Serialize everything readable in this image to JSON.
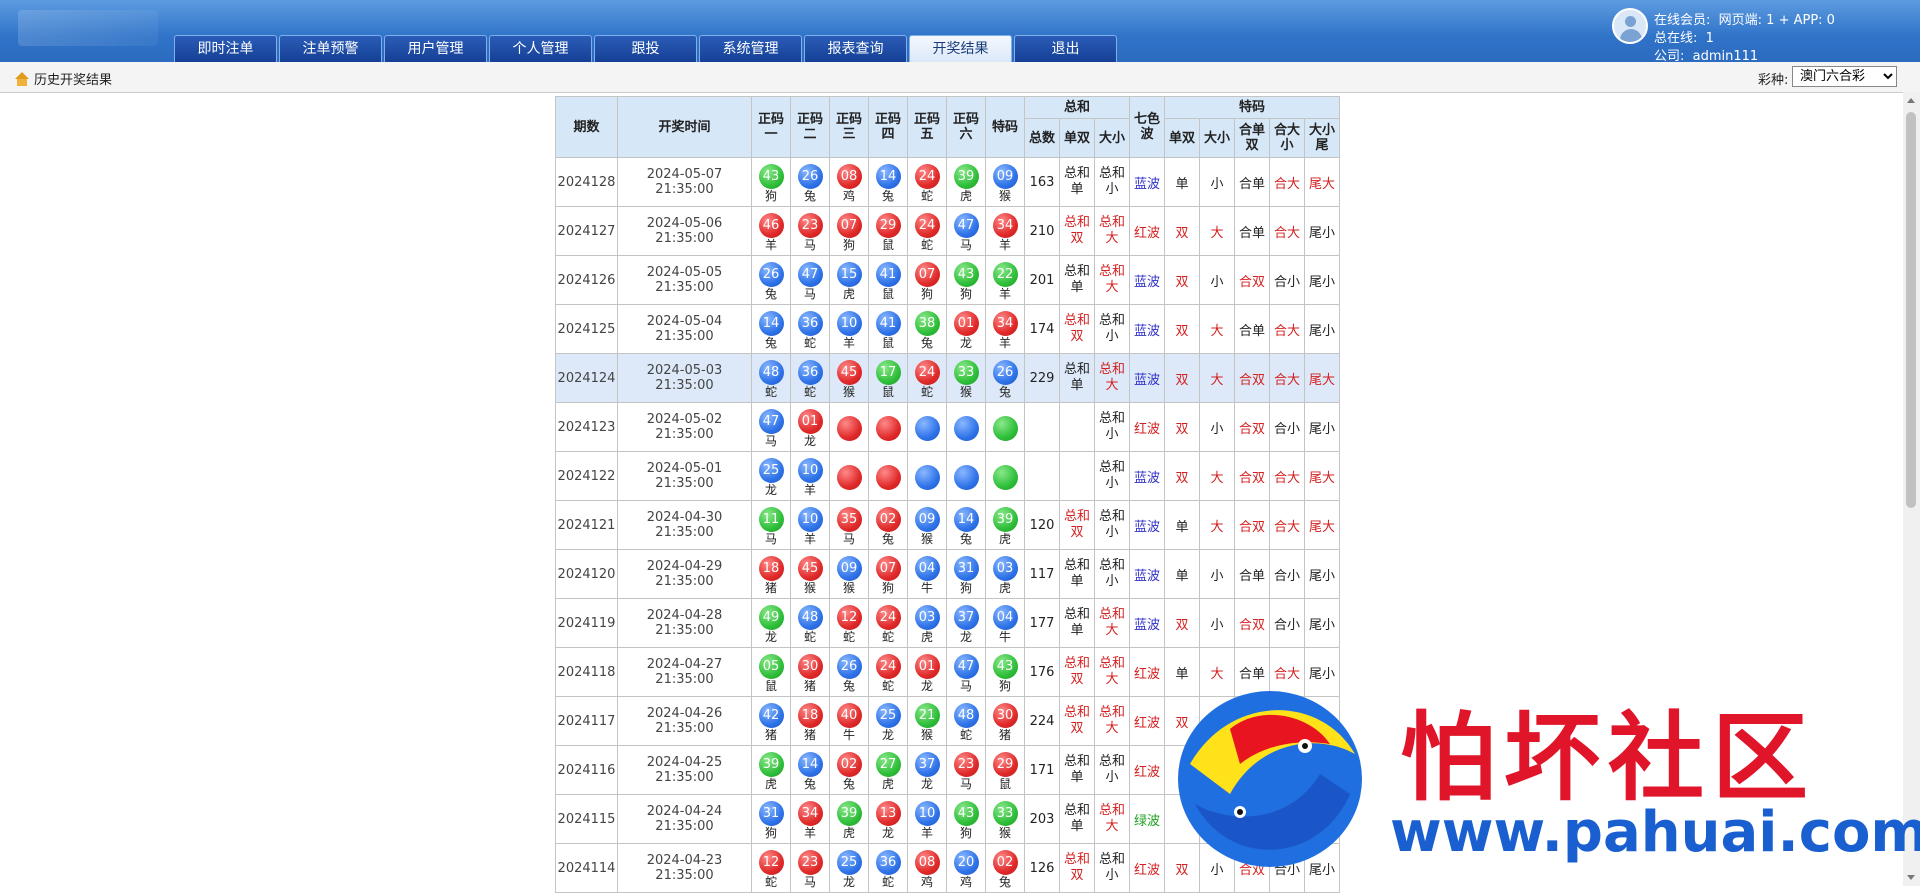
{
  "nav": [
    "即时注单",
    "注单预警",
    "用户管理",
    "个人管理",
    "跟投",
    "系统管理",
    "报表查询",
    "开奖结果",
    "退出"
  ],
  "nav_active": 7,
  "user": {
    "online_label": "在线会员:",
    "online_value": "网页端: 1 + APP: 0",
    "total_label": "总在线:",
    "total_value": "1",
    "company_label": "公司:",
    "company_value": "admin111"
  },
  "toolbar": {
    "breadcrumb": "历史开奖结果",
    "lottery_label": "彩种:",
    "lottery_selected": "澳门六合彩"
  },
  "table": {
    "headers": {
      "period": "期数",
      "time": "开奖时间",
      "z1": "正码一",
      "z2": "正码二",
      "z3": "正码三",
      "z4": "正码四",
      "z5": "正码五",
      "z6": "正码六",
      "special": "特码",
      "sum_group": "总和",
      "special_group": "特码",
      "sum_total": "总数",
      "sum_oe": "单双",
      "sum_bs": "大小",
      "color": "七色波",
      "sp_oe": "单双",
      "sp_bs": "大小",
      "sp_he_oe": "合单双",
      "sp_he_bs": "合大小",
      "sp_tail": "大小尾"
    },
    "rows": [
      {
        "period": "2024128",
        "time": "2024-05-07 21:35:00",
        "balls": [
          [
            "43",
            "狗",
            "green"
          ],
          [
            "26",
            "兔",
            "blue"
          ],
          [
            "08",
            "鸡",
            "red"
          ],
          [
            "14",
            "兔",
            "blue"
          ],
          [
            "24",
            "蛇",
            "red"
          ],
          [
            "39",
            "虎",
            "green"
          ],
          [
            "09",
            "猴",
            "blue"
          ]
        ],
        "total": "163",
        "sum_oe": [
          "总和",
          "单",
          "tblack"
        ],
        "sum_bs": [
          "总和",
          "小",
          "tblack"
        ],
        "color": [
          "蓝波",
          "tblue"
        ],
        "sp": [
          [
            "单",
            "tblack"
          ],
          [
            "小",
            "tblack"
          ],
          [
            "合单",
            "tblack"
          ],
          [
            "合大",
            "tred"
          ],
          [
            "尾大",
            "tred"
          ]
        ]
      },
      {
        "period": "2024127",
        "time": "2024-05-06 21:35:00",
        "balls": [
          [
            "46",
            "羊",
            "red"
          ],
          [
            "23",
            "马",
            "red"
          ],
          [
            "07",
            "狗",
            "red"
          ],
          [
            "29",
            "鼠",
            "red"
          ],
          [
            "24",
            "蛇",
            "red"
          ],
          [
            "47",
            "马",
            "blue"
          ],
          [
            "34",
            "羊",
            "red"
          ]
        ],
        "total": "210",
        "sum_oe": [
          "总和",
          "双",
          "tred"
        ],
        "sum_bs": [
          "总和",
          "大",
          "tred"
        ],
        "color": [
          "红波",
          "tred"
        ],
        "sp": [
          [
            "双",
            "tred"
          ],
          [
            "大",
            "tred"
          ],
          [
            "合单",
            "tblack"
          ],
          [
            "合大",
            "tred"
          ],
          [
            "尾小",
            "tblack"
          ]
        ]
      },
      {
        "period": "2024126",
        "time": "2024-05-05 21:35:00",
        "balls": [
          [
            "26",
            "兔",
            "blue"
          ],
          [
            "47",
            "马",
            "blue"
          ],
          [
            "15",
            "虎",
            "blue"
          ],
          [
            "41",
            "鼠",
            "blue"
          ],
          [
            "07",
            "狗",
            "red"
          ],
          [
            "43",
            "狗",
            "green"
          ],
          [
            "22",
            "羊",
            "green"
          ]
        ],
        "total": "201",
        "sum_oe": [
          "总和",
          "单",
          "tblack"
        ],
        "sum_bs": [
          "总和",
          "大",
          "tred"
        ],
        "color": [
          "蓝波",
          "tblue"
        ],
        "sp": [
          [
            "双",
            "tred"
          ],
          [
            "小",
            "tblack"
          ],
          [
            "合双",
            "tred"
          ],
          [
            "合小",
            "tblack"
          ],
          [
            "尾小",
            "tblack"
          ]
        ]
      },
      {
        "period": "2024125",
        "time": "2024-05-04 21:35:00",
        "balls": [
          [
            "14",
            "兔",
            "blue"
          ],
          [
            "36",
            "蛇",
            "blue"
          ],
          [
            "10",
            "羊",
            "blue"
          ],
          [
            "41",
            "鼠",
            "blue"
          ],
          [
            "38",
            "兔",
            "green"
          ],
          [
            "01",
            "龙",
            "red"
          ],
          [
            "34",
            "羊",
            "red"
          ]
        ],
        "total": "174",
        "sum_oe": [
          "总和",
          "双",
          "tred"
        ],
        "sum_bs": [
          "总和",
          "小",
          "tblack"
        ],
        "color": [
          "蓝波",
          "tblue"
        ],
        "sp": [
          [
            "双",
            "tred"
          ],
          [
            "大",
            "tred"
          ],
          [
            "合单",
            "tblack"
          ],
          [
            "合大",
            "tred"
          ],
          [
            "尾小",
            "tblack"
          ]
        ]
      },
      {
        "period": "2024124",
        "time": "2024-05-03 21:35:00",
        "balls": [
          [
            "48",
            "蛇",
            "blue"
          ],
          [
            "36",
            "蛇",
            "blue"
          ],
          [
            "45",
            "猴",
            "red"
          ],
          [
            "17",
            "鼠",
            "green"
          ],
          [
            "24",
            "蛇",
            "red"
          ],
          [
            "33",
            "猴",
            "green"
          ],
          [
            "26",
            "兔",
            "blue"
          ]
        ],
        "total": "229",
        "sum_oe": [
          "总和",
          "单",
          "tblack"
        ],
        "sum_bs": [
          "总和",
          "大",
          "tred"
        ],
        "color": [
          "蓝波",
          "tblue"
        ],
        "sp": [
          [
            "双",
            "tred"
          ],
          [
            "大",
            "tred"
          ],
          [
            "合双",
            "tred"
          ],
          [
            "合大",
            "tred"
          ],
          [
            "尾大",
            "tred"
          ]
        ]
      },
      {
        "period": "2024123",
        "time": "2024-05-02 21:35:00",
        "balls": [
          [
            "47",
            "马",
            "blue"
          ],
          [
            "01",
            "龙",
            "red"
          ],
          [
            "",
            "",
            "red"
          ],
          [
            "",
            "",
            "red"
          ],
          [
            "",
            "",
            "blue"
          ],
          [
            "",
            "",
            "blue"
          ],
          [
            "",
            "",
            "green"
          ]
        ],
        "total": "",
        "sum_oe": [
          "",
          "",
          "tblack"
        ],
        "sum_bs": [
          "总和",
          "小",
          "tblack"
        ],
        "color": [
          "红波",
          "tred"
        ],
        "sp": [
          [
            "双",
            "tred"
          ],
          [
            "小",
            "tblack"
          ],
          [
            "合双",
            "tred"
          ],
          [
            "合小",
            "tblack"
          ],
          [
            "尾小",
            "tblack"
          ]
        ]
      },
      {
        "period": "2024122",
        "time": "2024-05-01 21:35:00",
        "balls": [
          [
            "25",
            "龙",
            "blue"
          ],
          [
            "10",
            "羊",
            "blue"
          ],
          [
            "",
            "",
            "red"
          ],
          [
            "",
            "",
            "red"
          ],
          [
            "",
            "",
            "blue"
          ],
          [
            "",
            "",
            "blue"
          ],
          [
            "",
            "",
            "green"
          ]
        ],
        "total": "",
        "sum_oe": [
          "",
          "",
          "tblack"
        ],
        "sum_bs": [
          "总和",
          "小",
          "tblack"
        ],
        "color": [
          "蓝波",
          "tblue"
        ],
        "sp": [
          [
            "双",
            "tred"
          ],
          [
            "大",
            "tred"
          ],
          [
            "合双",
            "tred"
          ],
          [
            "合大",
            "tred"
          ],
          [
            "尾大",
            "tred"
          ]
        ]
      },
      {
        "period": "2024121",
        "time": "2024-04-30 21:35:00",
        "balls": [
          [
            "11",
            "马",
            "green"
          ],
          [
            "10",
            "羊",
            "blue"
          ],
          [
            "35",
            "马",
            "red"
          ],
          [
            "02",
            "兔",
            "red"
          ],
          [
            "09",
            "猴",
            "blue"
          ],
          [
            "14",
            "兔",
            "blue"
          ],
          [
            "39",
            "虎",
            "green"
          ]
        ],
        "total": "120",
        "sum_oe": [
          "总和",
          "双",
          "tred"
        ],
        "sum_bs": [
          "总和",
          "小",
          "tblack"
        ],
        "color": [
          "蓝波",
          "tblue"
        ],
        "sp": [
          [
            "单",
            "tblack"
          ],
          [
            "大",
            "tred"
          ],
          [
            "合双",
            "tred"
          ],
          [
            "合大",
            "tred"
          ],
          [
            "尾大",
            "tred"
          ]
        ]
      },
      {
        "period": "2024120",
        "time": "2024-04-29 21:35:00",
        "balls": [
          [
            "18",
            "猪",
            "red"
          ],
          [
            "45",
            "猴",
            "red"
          ],
          [
            "09",
            "猴",
            "blue"
          ],
          [
            "07",
            "狗",
            "red"
          ],
          [
            "04",
            "牛",
            "blue"
          ],
          [
            "31",
            "狗",
            "blue"
          ],
          [
            "03",
            "虎",
            "blue"
          ]
        ],
        "total": "117",
        "sum_oe": [
          "总和",
          "单",
          "tblack"
        ],
        "sum_bs": [
          "总和",
          "小",
          "tblack"
        ],
        "color": [
          "蓝波",
          "tblue"
        ],
        "sp": [
          [
            "单",
            "tblack"
          ],
          [
            "小",
            "tblack"
          ],
          [
            "合单",
            "tblack"
          ],
          [
            "合小",
            "tblack"
          ],
          [
            "尾小",
            "tblack"
          ]
        ]
      },
      {
        "period": "2024119",
        "time": "2024-04-28 21:35:00",
        "balls": [
          [
            "49",
            "龙",
            "green"
          ],
          [
            "48",
            "蛇",
            "blue"
          ],
          [
            "12",
            "蛇",
            "red"
          ],
          [
            "24",
            "蛇",
            "red"
          ],
          [
            "03",
            "虎",
            "blue"
          ],
          [
            "37",
            "龙",
            "blue"
          ],
          [
            "04",
            "牛",
            "blue"
          ]
        ],
        "total": "177",
        "sum_oe": [
          "总和",
          "单",
          "tblack"
        ],
        "sum_bs": [
          "总和",
          "大",
          "tred"
        ],
        "color": [
          "蓝波",
          "tblue"
        ],
        "sp": [
          [
            "双",
            "tred"
          ],
          [
            "小",
            "tblack"
          ],
          [
            "合双",
            "tred"
          ],
          [
            "合小",
            "tblack"
          ],
          [
            "尾小",
            "tblack"
          ]
        ]
      },
      {
        "period": "2024118",
        "time": "2024-04-27 21:35:00",
        "balls": [
          [
            "05",
            "鼠",
            "green"
          ],
          [
            "30",
            "猪",
            "red"
          ],
          [
            "26",
            "兔",
            "blue"
          ],
          [
            "24",
            "蛇",
            "red"
          ],
          [
            "01",
            "龙",
            "red"
          ],
          [
            "47",
            "马",
            "blue"
          ],
          [
            "43",
            "狗",
            "green"
          ]
        ],
        "total": "176",
        "sum_oe": [
          "总和",
          "双",
          "tred"
        ],
        "sum_bs": [
          "总和",
          "大",
          "tred"
        ],
        "color": [
          "红波",
          "tred"
        ],
        "sp": [
          [
            "单",
            "tblack"
          ],
          [
            "大",
            "tred"
          ],
          [
            "合单",
            "tblack"
          ],
          [
            "合大",
            "tred"
          ],
          [
            "尾小",
            "tblack"
          ]
        ]
      },
      {
        "period": "2024117",
        "time": "2024-04-26 21:35:00",
        "balls": [
          [
            "42",
            "猪",
            "blue"
          ],
          [
            "18",
            "猪",
            "red"
          ],
          [
            "40",
            "牛",
            "red"
          ],
          [
            "25",
            "龙",
            "blue"
          ],
          [
            "21",
            "猴",
            "green"
          ],
          [
            "48",
            "蛇",
            "blue"
          ],
          [
            "30",
            "猪",
            "red"
          ]
        ],
        "total": "224",
        "sum_oe": [
          "总和",
          "双",
          "tred"
        ],
        "sum_bs": [
          "总和",
          "大",
          "tred"
        ],
        "color": [
          "红波",
          "tred"
        ],
        "sp": [
          [
            "双",
            "tred"
          ],
          [
            "",
            "tblack"
          ],
          [
            "",
            "tblack"
          ],
          [
            "",
            "tblack"
          ],
          [
            "",
            "tblack"
          ]
        ]
      },
      {
        "period": "2024116",
        "time": "2024-04-25 21:35:00",
        "balls": [
          [
            "39",
            "虎",
            "green"
          ],
          [
            "14",
            "兔",
            "blue"
          ],
          [
            "02",
            "兔",
            "red"
          ],
          [
            "27",
            "虎",
            "green"
          ],
          [
            "37",
            "龙",
            "blue"
          ],
          [
            "23",
            "马",
            "red"
          ],
          [
            "29",
            "鼠",
            "red"
          ]
        ],
        "total": "171",
        "sum_oe": [
          "总和",
          "单",
          "tblack"
        ],
        "sum_bs": [
          "总和",
          "小",
          "tblack"
        ],
        "color": [
          "红波",
          "tred"
        ],
        "sp": [
          [
            "",
            "tblack"
          ],
          [
            "",
            "tblack"
          ],
          [
            "",
            "tblack"
          ],
          [
            "",
            "tblack"
          ],
          [
            "",
            "tblack"
          ]
        ]
      },
      {
        "period": "2024115",
        "time": "2024-04-24 21:35:00",
        "balls": [
          [
            "31",
            "狗",
            "blue"
          ],
          [
            "34",
            "羊",
            "red"
          ],
          [
            "39",
            "虎",
            "green"
          ],
          [
            "13",
            "龙",
            "red"
          ],
          [
            "10",
            "羊",
            "blue"
          ],
          [
            "43",
            "狗",
            "green"
          ],
          [
            "33",
            "猴",
            "green"
          ]
        ],
        "total": "203",
        "sum_oe": [
          "总和",
          "单",
          "tblack"
        ],
        "sum_bs": [
          "总和",
          "大",
          "tred"
        ],
        "color": [
          "绿波",
          "tgreen"
        ],
        "sp": [
          [
            "",
            "tblack"
          ],
          [
            "",
            "tblack"
          ],
          [
            "",
            "tblack"
          ],
          [
            "",
            "tblack"
          ],
          [
            "",
            "tblack"
          ]
        ]
      },
      {
        "period": "2024114",
        "time": "2024-04-23 21:35:00",
        "balls": [
          [
            "12",
            "蛇",
            "red"
          ],
          [
            "23",
            "马",
            "red"
          ],
          [
            "25",
            "龙",
            "blue"
          ],
          [
            "36",
            "蛇",
            "blue"
          ],
          [
            "08",
            "鸡",
            "red"
          ],
          [
            "20",
            "鸡",
            "blue"
          ],
          [
            "02",
            "兔",
            "red"
          ]
        ],
        "total": "126",
        "sum_oe": [
          "总和",
          "双",
          "tred"
        ],
        "sum_bs": [
          "总和",
          "小",
          "tblack"
        ],
        "color": [
          "红波",
          "tred"
        ],
        "sp": [
          [
            "双",
            "tred"
          ],
          [
            "小",
            "tblack"
          ],
          [
            "合双",
            "tred"
          ],
          [
            "合小",
            "tblack"
          ],
          [
            "尾小",
            "tblack"
          ]
        ]
      }
    ],
    "highlight_row": 4
  },
  "watermark": {
    "title": "怕坏社区",
    "url": "www.pahuai.com"
  },
  "colors": {
    "header_blue": "#2f73c8",
    "ball_red": "#e02a2a",
    "ball_blue": "#2f73e8",
    "ball_green": "#2fbf3a"
  }
}
